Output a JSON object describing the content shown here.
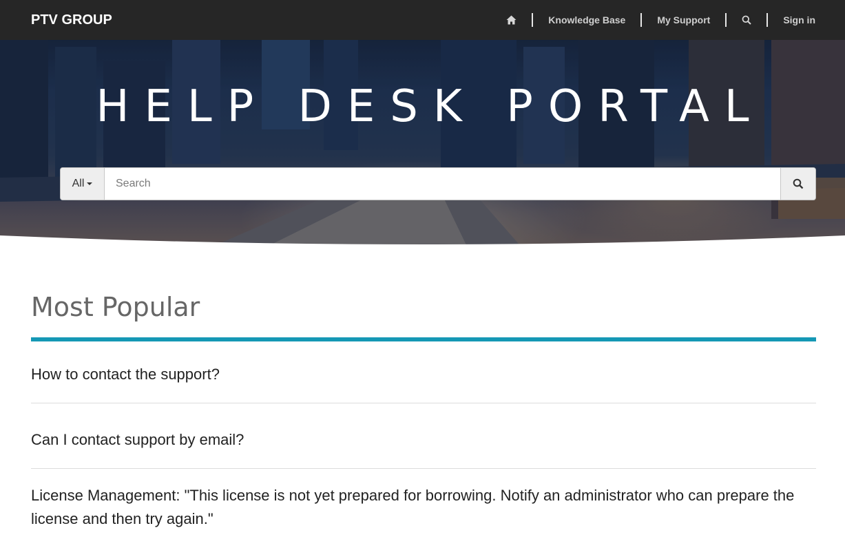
{
  "header": {
    "logo": "PTV GROUP",
    "nav": [
      {
        "type": "icon",
        "icon": "home-icon"
      },
      {
        "type": "link",
        "label": "Knowledge Base"
      },
      {
        "type": "link",
        "label": "My Support"
      },
      {
        "type": "icon",
        "icon": "search-icon"
      },
      {
        "type": "link",
        "label": "Sign in"
      }
    ],
    "knowledge_base_label": "Knowledge Base",
    "my_support_label": "My Support",
    "sign_in_label": "Sign in"
  },
  "hero": {
    "title": "HELP DESK PORTAL"
  },
  "search": {
    "scope_value": "All",
    "placeholder": "Search",
    "button_icon": "search-icon"
  },
  "popular": {
    "title": "Most Popular",
    "items": [
      "How to contact the support?",
      "Can I contact support by email?",
      "License Management: \"This license is not yet prepared for borrowing. Notify an administrator who can prepare the license and then try again.\""
    ]
  },
  "colors": {
    "topnav_bg": "#262626",
    "accent": "#1598b5",
    "title_gray": "#666666"
  }
}
